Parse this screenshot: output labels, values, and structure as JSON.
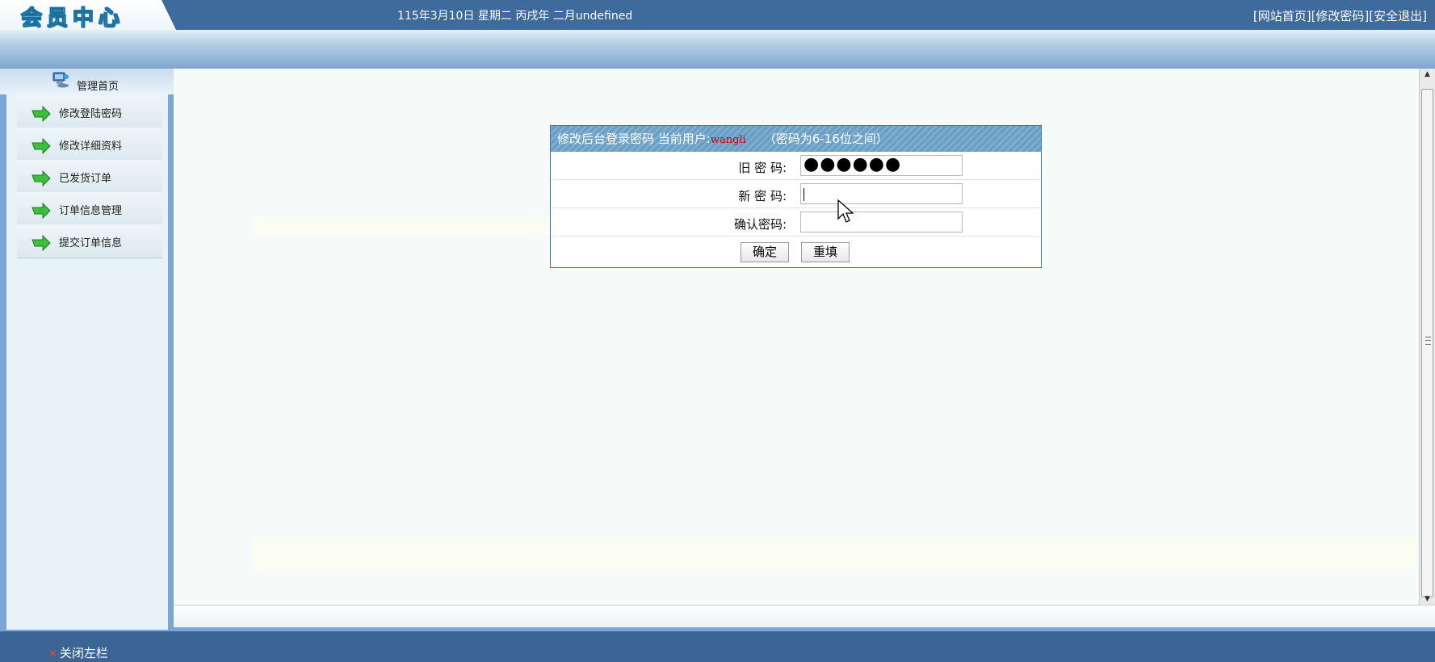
{
  "header": {
    "logo": "会员中心",
    "date": "115年3月10日 星期二 丙戌年 二月undefined",
    "links": [
      "[网站首页]",
      "[修改密码]",
      "[安全退出]"
    ]
  },
  "sidebar": {
    "home_label": "管理首页",
    "items": [
      {
        "label": "修改登陆密码"
      },
      {
        "label": "修改详细资料"
      },
      {
        "label": "已发货订单"
      },
      {
        "label": "订单信息管理"
      },
      {
        "label": "提交订单信息"
      }
    ],
    "close_label": "关闭左栏"
  },
  "form": {
    "title_prefix": "修改后台登录密码 当前用户:",
    "user": "wangli",
    "hint": "（密码为6-16位之间）",
    "old_label": "旧 密 码:",
    "old_value": "●●●●●●",
    "new_label": "新 密 码:",
    "new_value": "",
    "confirm_label": "确认密码:",
    "confirm_value": "",
    "submit_label": "确定",
    "reset_label": "重填"
  },
  "colors": {
    "accent": "#3a72b8",
    "title_bg": "#6a9fc6",
    "user_text": "#cc0000"
  }
}
